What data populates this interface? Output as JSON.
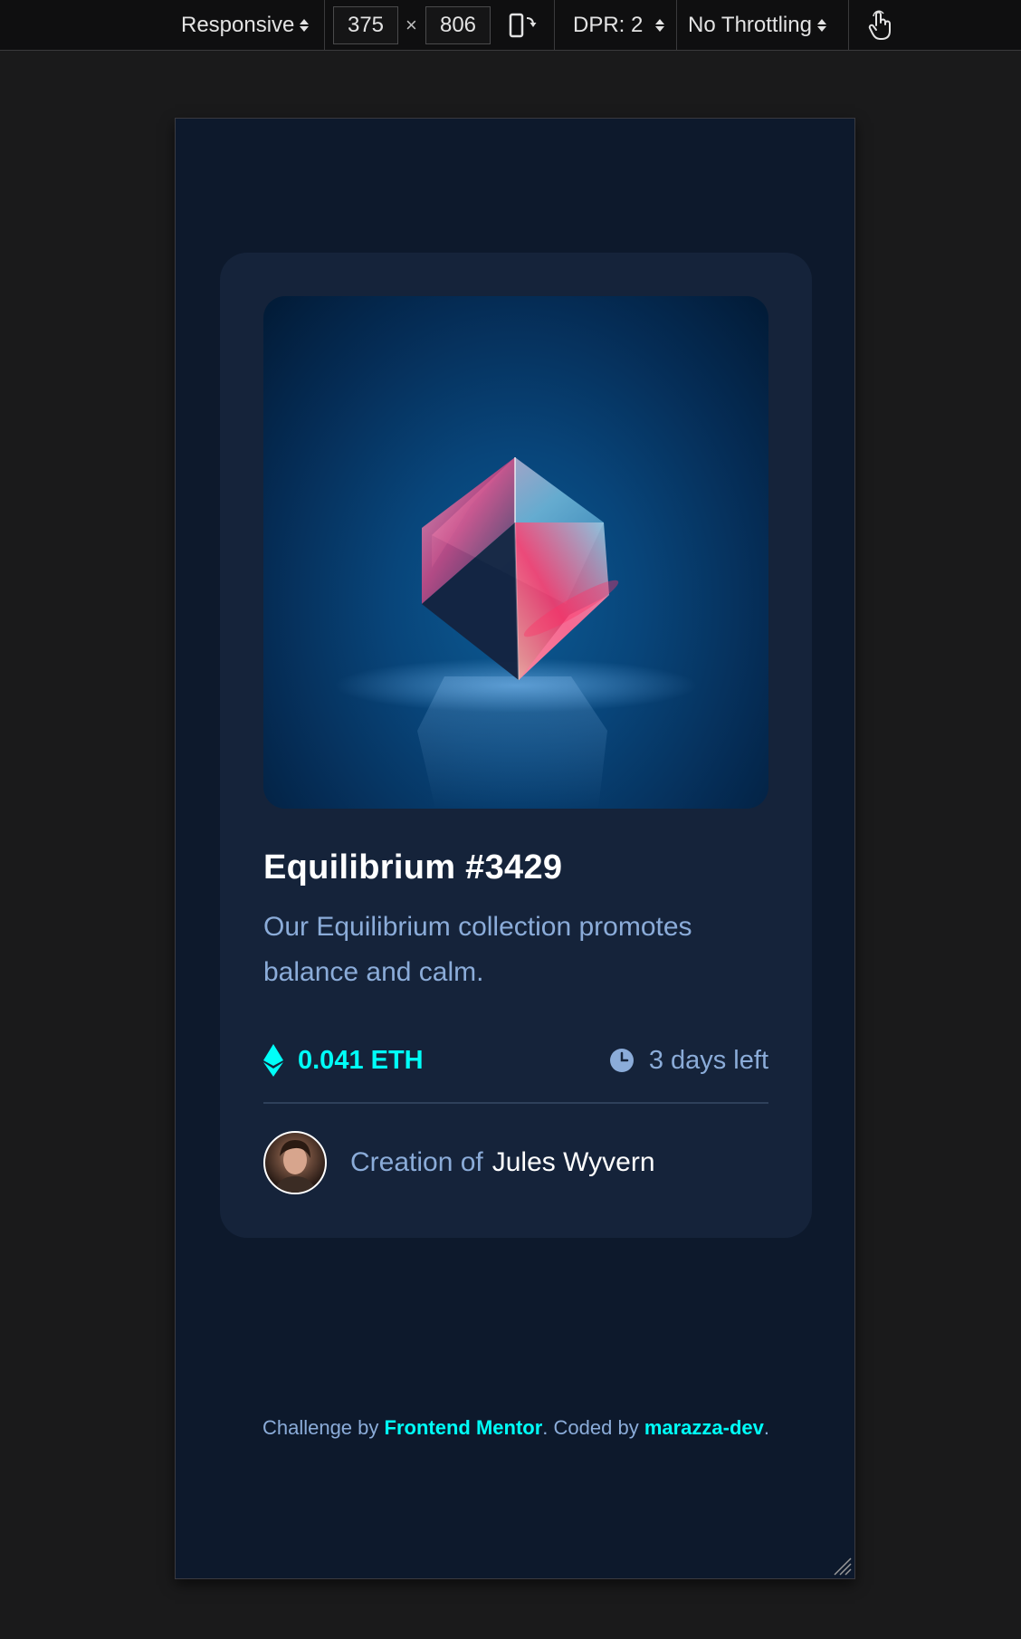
{
  "devtools": {
    "device_mode": "Responsive",
    "width": "375",
    "times": "×",
    "height": "806",
    "dpr": "DPR: 2",
    "throttling": "No Throttling",
    "icons": [
      "rotate-device-icon",
      "touch-hand-icon",
      "updown-arrows-icon"
    ]
  },
  "card": {
    "title": "Equilibrium #3429",
    "description": "Our Equilibrium collection promotes balance and calm.",
    "price": "0.041 ETH",
    "time_left": "3 days left",
    "creator_prefix": "Creation of",
    "creator_name": "Jules Wyvern",
    "icons": [
      "ethereum-icon",
      "clock-icon"
    ]
  },
  "footer": {
    "prefix": "Challenge by",
    "link1": "Frontend Mentor",
    "middle": ". Coded by",
    "link2": "marazza-dev",
    "suffix": "."
  },
  "colors": {
    "page_bg": "#0d192c",
    "card_bg": "#15233a",
    "accent_cyan": "#00fff8",
    "soft_blue": "#8bacd9",
    "white": "#ffffff"
  }
}
